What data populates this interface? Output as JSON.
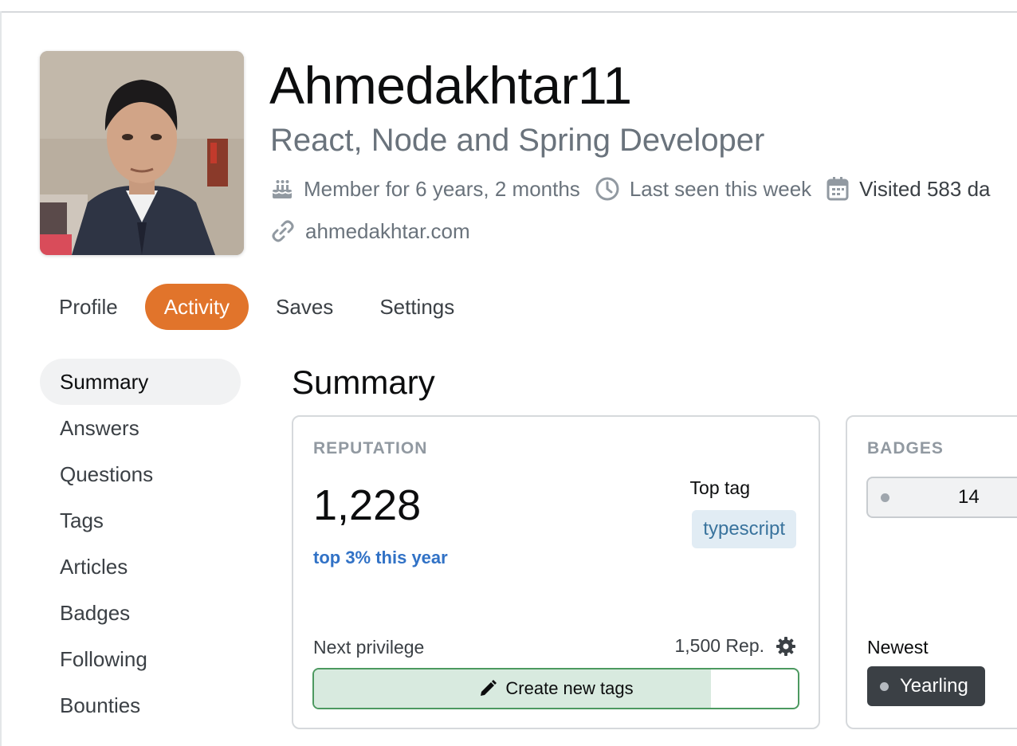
{
  "profile": {
    "username": "Ahmedakhtar11",
    "title": "React, Node and Spring Developer",
    "member_for": "Member for 6 years, 2 months",
    "last_seen": "Last seen this week",
    "visited": "Visited 583 da",
    "website": "ahmedakhtar.com"
  },
  "nav": {
    "tabs": [
      {
        "label": "Profile"
      },
      {
        "label": "Activity"
      },
      {
        "label": "Saves"
      },
      {
        "label": "Settings"
      }
    ],
    "active": "Activity"
  },
  "sidebar": {
    "items": [
      {
        "label": "Summary"
      },
      {
        "label": "Answers"
      },
      {
        "label": "Questions"
      },
      {
        "label": "Tags"
      },
      {
        "label": "Articles"
      },
      {
        "label": "Badges"
      },
      {
        "label": "Following"
      },
      {
        "label": "Bounties"
      }
    ],
    "active": "Summary"
  },
  "summary": {
    "title": "Summary",
    "reputation": {
      "label": "REPUTATION",
      "value": "1,228",
      "rank": "top 3% this year",
      "top_tag_label": "Top tag",
      "top_tag": "typescript",
      "next_privilege_label": "Next privilege",
      "next_privilege_requirement": "1,500 Rep.",
      "next_privilege_name": "Create new tags",
      "progress_fraction": 0.82
    },
    "badges": {
      "label": "BADGES",
      "bronze_count": "14",
      "newest_label": "Newest",
      "newest_badge": "Yearling"
    }
  },
  "colors": {
    "accent": "#e1742b",
    "link": "#3172c6",
    "tag_bg": "#e1ecf4",
    "progress_border": "#4c9960",
    "progress_fill": "#d8eadf"
  },
  "icons": [
    "cake-icon",
    "clock-icon",
    "calendar-icon",
    "link-icon",
    "gear-icon",
    "pencil-icon"
  ]
}
